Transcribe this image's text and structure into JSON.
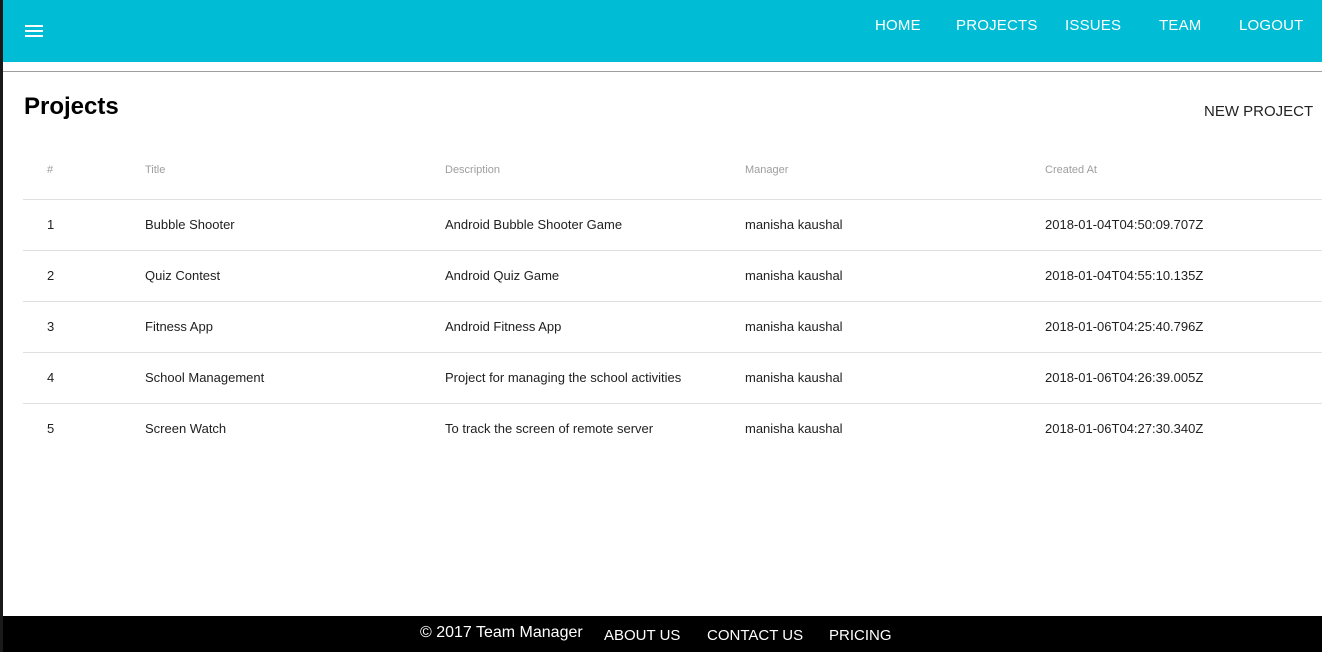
{
  "header": {
    "nav": [
      "HOME",
      "PROJECTS",
      "ISSUES",
      "TEAM",
      "LOGOUT"
    ]
  },
  "page": {
    "title": "Projects",
    "new_project_label": "NEW PROJECT"
  },
  "table": {
    "columns": [
      "#",
      "Title",
      "Description",
      "Manager",
      "Created At"
    ],
    "rows": [
      [
        "1",
        "Bubble Shooter",
        "Android Bubble Shooter Game",
        "manisha kaushal",
        "2018-01-04T04:50:09.707Z"
      ],
      [
        "2",
        "Quiz Contest",
        "Android Quiz Game",
        "manisha kaushal",
        "2018-01-04T04:55:10.135Z"
      ],
      [
        "3",
        "Fitness App",
        "Android Fitness App",
        "manisha kaushal",
        "2018-01-06T04:25:40.796Z"
      ],
      [
        "4",
        "School Management",
        "Project for managing the school activities",
        "manisha kaushal",
        "2018-01-06T04:26:39.005Z"
      ],
      [
        "5",
        "Screen Watch",
        "To track the screen of remote server",
        "manisha kaushal",
        "2018-01-06T04:27:30.340Z"
      ]
    ]
  },
  "footer": {
    "copyright": "© 2017 Team Manager",
    "links": [
      "ABOUT US",
      "CONTACT US",
      "PRICING"
    ]
  },
  "icons": {
    "menu": "hamburger-menu-icon"
  },
  "colors": {
    "appbar": "#00bcd4",
    "footer": "#000000"
  }
}
